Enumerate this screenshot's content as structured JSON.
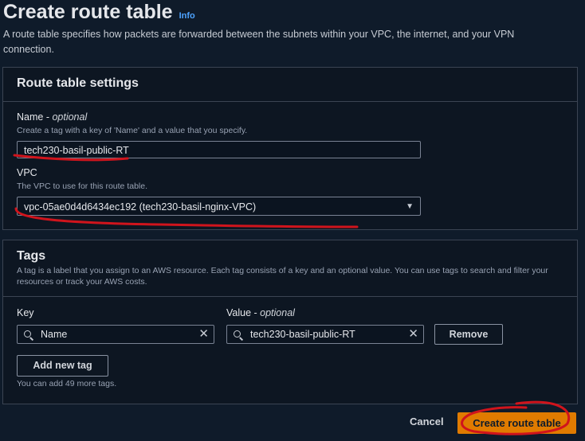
{
  "header": {
    "title": "Create route table",
    "info": "Info",
    "description": "A route table specifies how packets are forwarded between the subnets within your VPC, the internet, and your VPN connection."
  },
  "settings": {
    "title": "Route table settings",
    "name_label": "Name - ",
    "name_optional": "optional",
    "name_hint": "Create a tag with a key of 'Name' and a value that you specify.",
    "name_value": "tech230-basil-public-RT",
    "vpc_label": "VPC",
    "vpc_hint": "The VPC to use for this route table.",
    "vpc_value": "vpc-05ae0d4d6434ec192 (tech230-basil-nginx-VPC)"
  },
  "tags": {
    "title": "Tags",
    "description": "A tag is a label that you assign to an AWS resource. Each tag consists of a key and an optional value. You can use tags to search and filter your resources or track your AWS costs.",
    "key_label": "Key",
    "value_label": "Value - ",
    "value_optional": "optional",
    "key_value": "Name",
    "value_value": "tech230-basil-public-RT",
    "remove_label": "Remove",
    "add_label": "Add new tag",
    "remaining": "You can add 49 more tags."
  },
  "footer": {
    "cancel": "Cancel",
    "create": "Create route table"
  },
  "colors": {
    "background": "#0f1b2a",
    "primary": "#e07b00",
    "link": "#4da3ff",
    "annotation": "#d0141c"
  }
}
